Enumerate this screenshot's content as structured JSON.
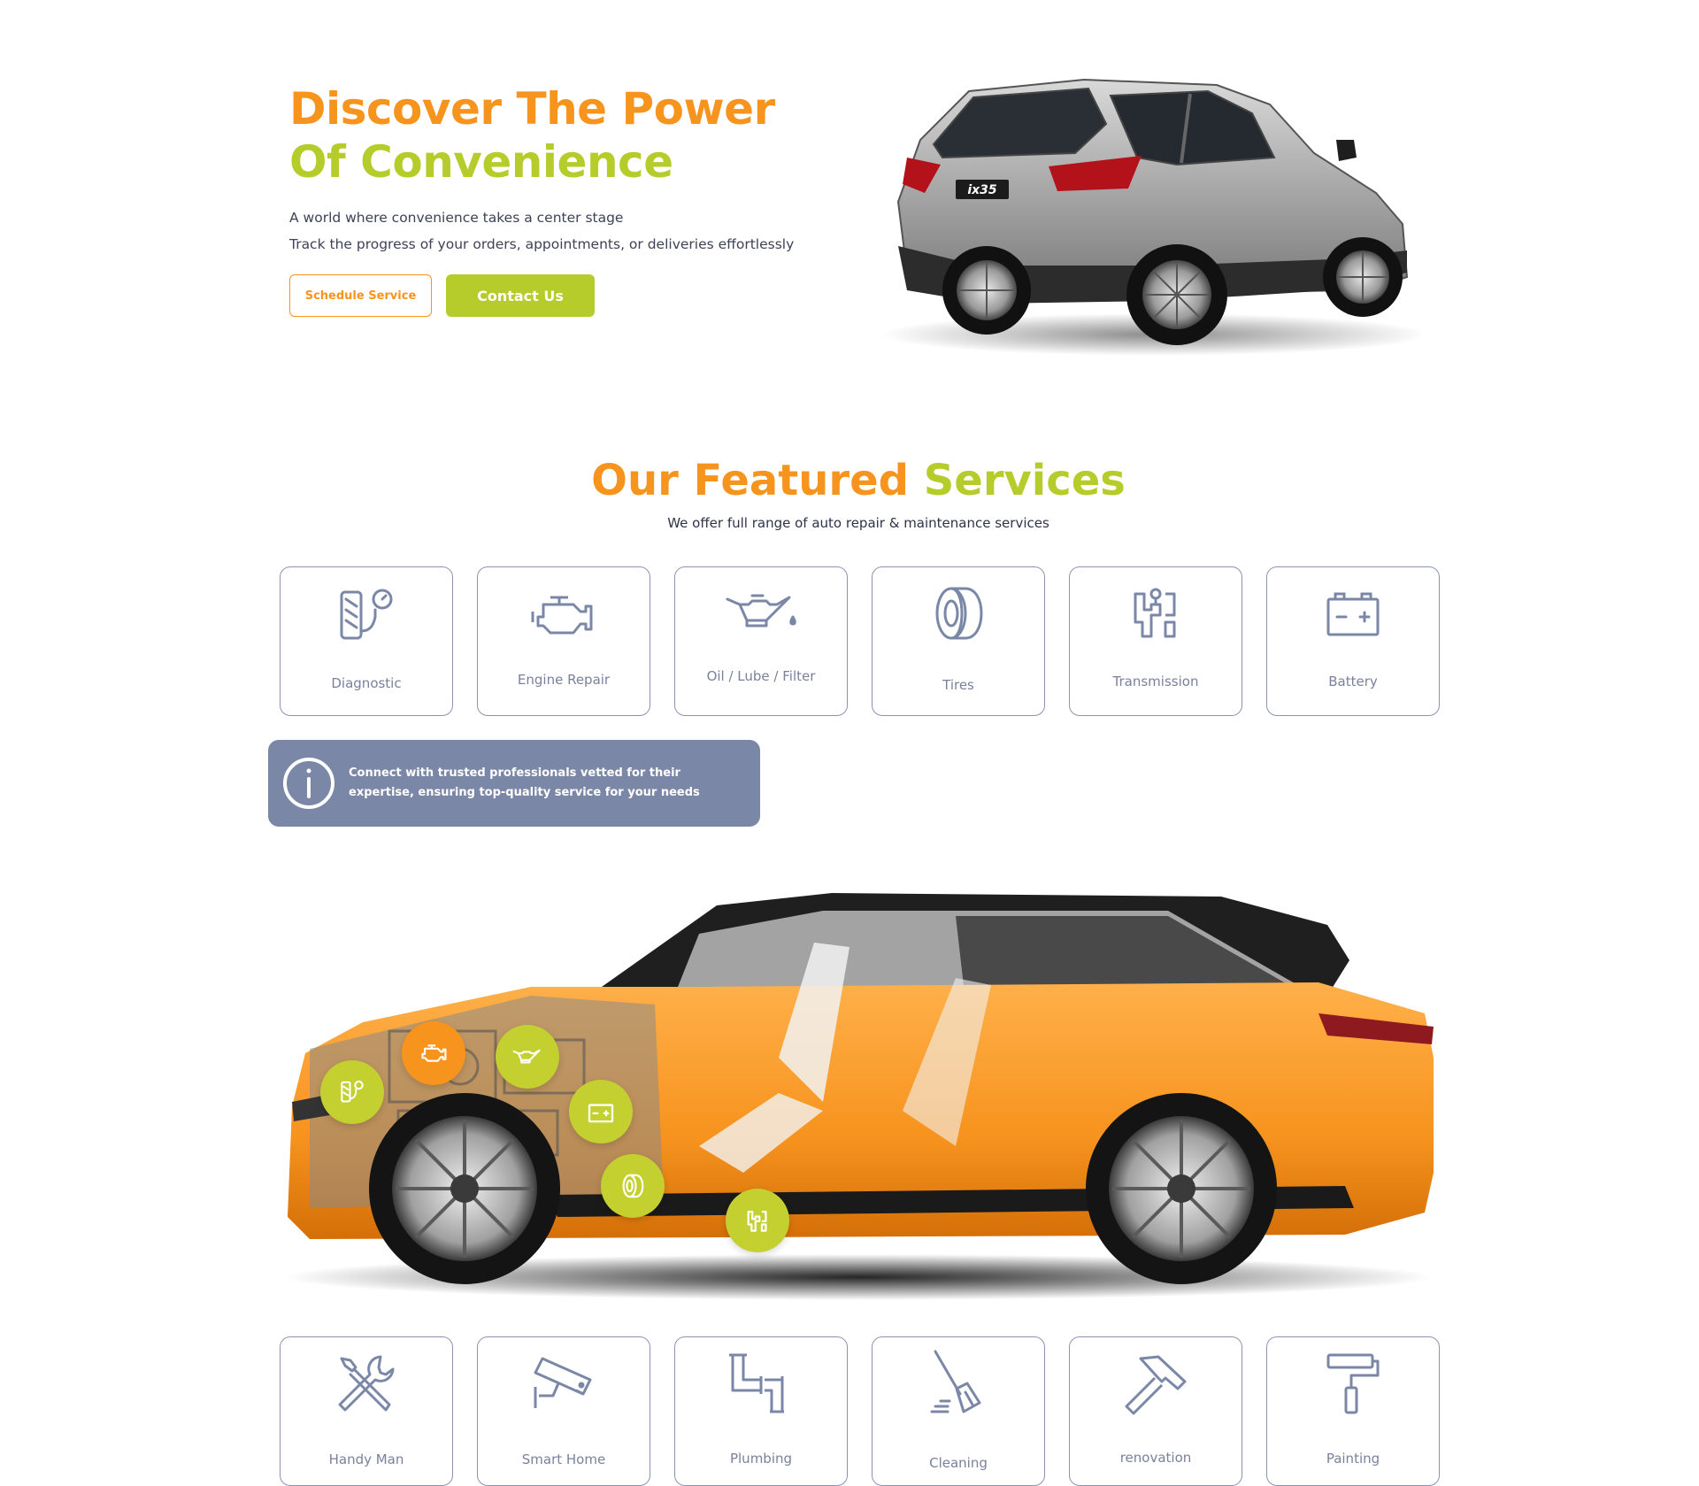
{
  "hero": {
    "title_line1": "Discover The Power",
    "title_line2": "Of Convenience",
    "sub_line1": "A world where convenience takes a center stage",
    "sub_line2": "Track the progress of your orders, appointments, or deliveries effortlessly",
    "schedule_label": "Schedule Service",
    "contact_label": "Contact Us",
    "car_plate": "ix35"
  },
  "services_section": {
    "title_part1": "Our Featured",
    "title_part2": "Services",
    "subtitle": "We offer full range of auto repair & maintenance services"
  },
  "auto_services": [
    {
      "label": "Diagnostic",
      "icon": "diagnostic-icon"
    },
    {
      "label": "Engine Repair",
      "icon": "engine-icon"
    },
    {
      "label": "Oil / Lube / Filter",
      "icon": "oil-can-icon"
    },
    {
      "label": "Tires",
      "icon": "tire-icon"
    },
    {
      "label": "Transmission",
      "icon": "transmission-icon"
    },
    {
      "label": "Battery",
      "icon": "battery-icon"
    }
  ],
  "info": {
    "text": "Connect with trusted professionals vetted for their expertise, ensuring top-quality service for your needs",
    "icon": "info-icon"
  },
  "hotspots": [
    {
      "icon": "diagnostic-icon",
      "color": "#c3d02f"
    },
    {
      "icon": "engine-icon",
      "color": "#f7941d"
    },
    {
      "icon": "oil-can-icon",
      "color": "#c3d02f"
    },
    {
      "icon": "battery-icon",
      "color": "#c3d02f"
    },
    {
      "icon": "tire-icon",
      "color": "#c3d02f"
    },
    {
      "icon": "transmission-icon",
      "color": "#c3d02f"
    }
  ],
  "home_services": [
    {
      "label": "Handy Man",
      "icon": "wrench-screwdriver-icon"
    },
    {
      "label": "Smart Home",
      "icon": "security-camera-icon"
    },
    {
      "label": "Plumbing",
      "icon": "pipes-icon"
    },
    {
      "label": "Cleaning",
      "icon": "broom-icon"
    },
    {
      "label": "renovation",
      "icon": "hammer-icon"
    },
    {
      "label": "Painting",
      "icon": "paint-roller-icon"
    }
  ],
  "colors": {
    "orange": "#f7941d",
    "green": "#b5cc2b",
    "slate": "#7b87a6",
    "card_border": "#8b93b0",
    "card_text": "#7a819c"
  }
}
